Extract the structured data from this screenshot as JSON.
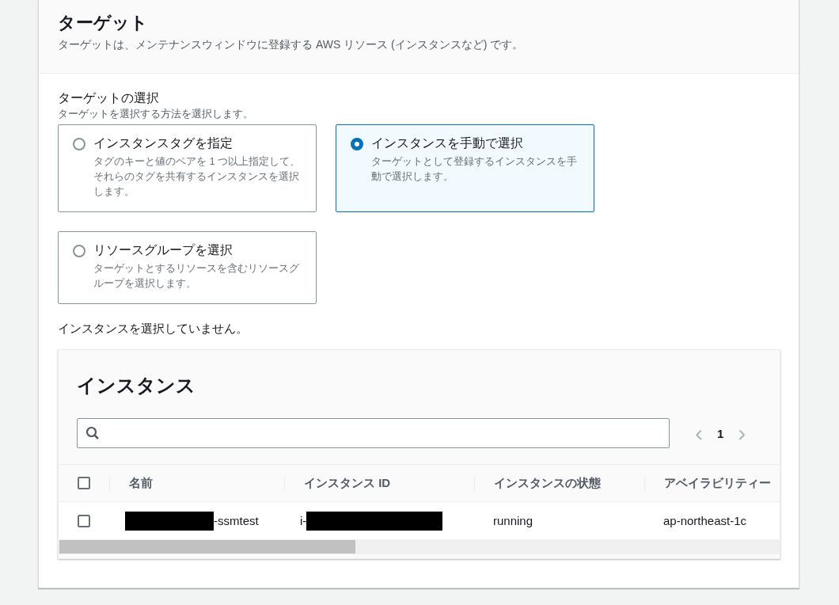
{
  "section": {
    "title": "ターゲット",
    "description": "ターゲットは、メンテナンスウィンドウに登録する AWS リソース (インスタンスなど) です。"
  },
  "target_selection": {
    "label": "ターゲットの選択",
    "hint": "ターゲットを選択する方法を選択します。",
    "options": [
      {
        "title": "インスタンスタグを指定",
        "description": "タグのキーと値のペアを 1 つ以上指定して、それらのタグを共有するインスタンスを選択します。",
        "selected": false
      },
      {
        "title": "インスタンスを手動で選択",
        "description": "ターゲットとして登録するインスタンスを手動で選択します。",
        "selected": true
      },
      {
        "title": "リソースグループを選択",
        "description": "ターゲットとするリソースを含むリソースグループを選択します。",
        "selected": false
      }
    ]
  },
  "status_message": "インスタンスを選択していません。",
  "instances": {
    "title": "インスタンス",
    "pagination": {
      "prev": "‹",
      "page": "1",
      "next": "›"
    },
    "columns": [
      "名前",
      "インスタンス ID",
      "インスタンスの状態",
      "アベイラビリティー"
    ],
    "header_checked": false,
    "rows": [
      {
        "checked": false,
        "cells": [
          {
            "text": "-ssmtest",
            "redacted": true
          },
          {
            "text": "i-",
            "redacted": true
          },
          {
            "text": "running",
            "redacted": false
          },
          {
            "text": "ap-northeast-1c",
            "redacted": false
          }
        ]
      }
    ]
  }
}
